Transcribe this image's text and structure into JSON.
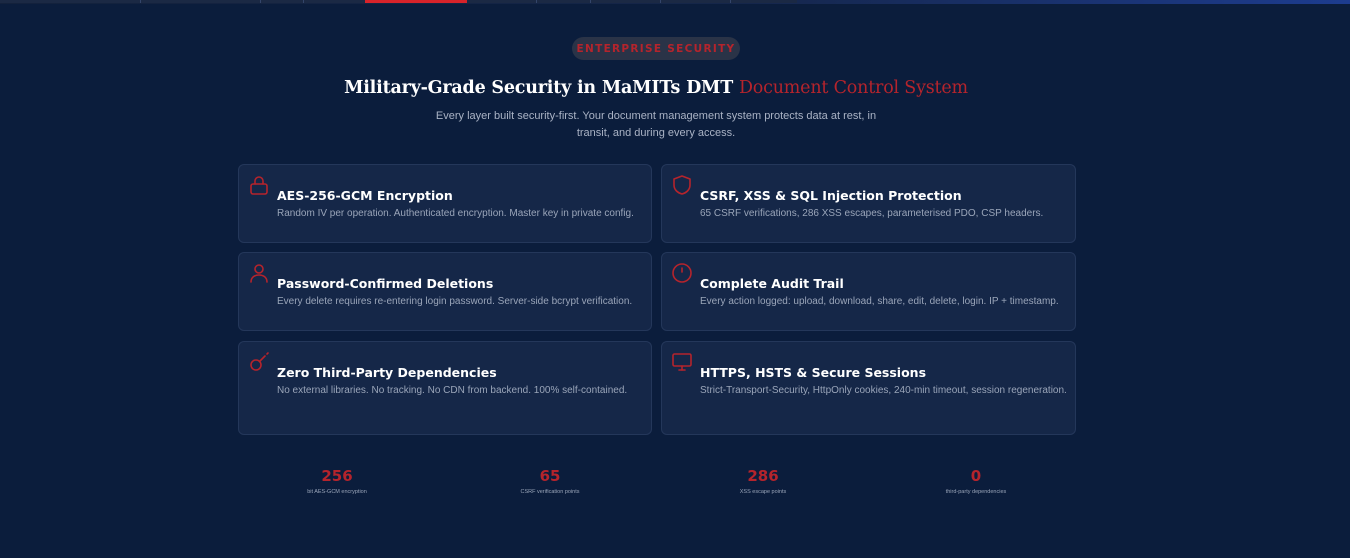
{
  "badge": {
    "label": "ENTERPRISE SECURITY"
  },
  "headline": {
    "main": "Military-Grade Security in MaMITs DMT",
    "accent": "Document Control System"
  },
  "subtitle": "Every layer built security-first. Your document management system protects data at rest, in transit, and during every access.",
  "features": [
    {
      "icon": "lock-icon",
      "title": "AES-256-GCM Encryption",
      "desc": "Random IV per operation. Authenticated encryption. Master key in private config."
    },
    {
      "icon": "shield-icon",
      "title": "CSRF, XSS & SQL Injection Protection",
      "desc": "65 CSRF verifications, 286 XSS escapes, parameterised PDO, CSP headers."
    },
    {
      "icon": "user-icon",
      "title": "Password-Confirmed Deletions",
      "desc": "Every delete requires re-entering login password. Server-side bcrypt verification."
    },
    {
      "icon": "clock-icon",
      "title": "Complete Audit Trail",
      "desc": "Every action logged: upload, download, share, edit, delete, login. IP + timestamp."
    },
    {
      "icon": "unlink-icon",
      "title": "Zero Third-Party Dependencies",
      "desc": "No external libraries. No tracking. No CDN from backend. 100% self-contained."
    },
    {
      "icon": "monitor-icon",
      "title": "HTTPS, HSTS & Secure Sessions",
      "desc": "Strict-Transport-Security, HttpOnly cookies, 240-min timeout, session regeneration."
    }
  ],
  "stats": [
    {
      "value": "256",
      "label": "bit AES-GCM encryption"
    },
    {
      "value": "65",
      "label": "CSRF verification points"
    },
    {
      "value": "286",
      "label": "XSS escape points"
    },
    {
      "value": "0",
      "label": "third-party dependencies"
    }
  ],
  "colors": {
    "accent": "#b5242c",
    "background": "#0b1d3c",
    "card": "#152748"
  }
}
